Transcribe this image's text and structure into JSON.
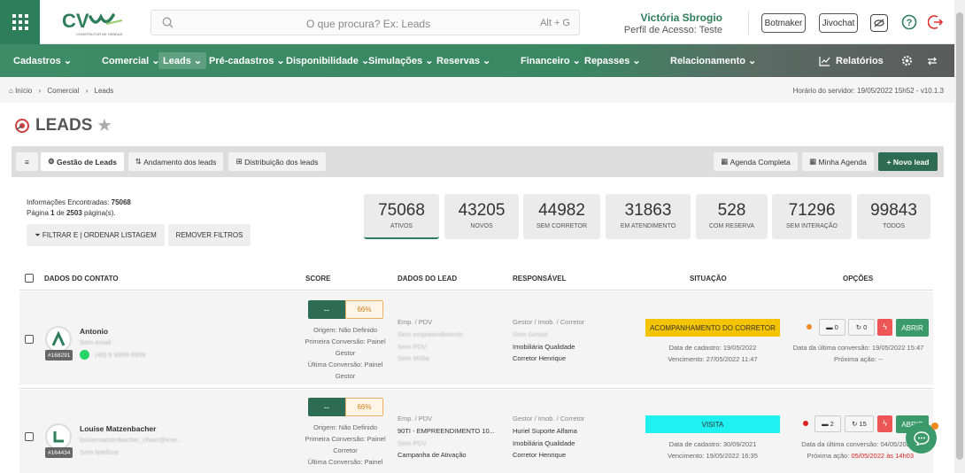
{
  "header": {
    "search_placeholder": "O que procura? Ex: Leads",
    "search_shortcut": "Alt + G",
    "user_name": "Victória Sbrogio",
    "user_profile": "Perfil de Acesso: Teste",
    "btn_botmaker": "Botmaker",
    "btn_jivochat": "Jivochat",
    "logo_sub": "CONSTRUTOR DE VENDAS"
  },
  "nav": {
    "items": [
      "Cadastros",
      "Comercial",
      "Leads",
      "Pré-cadastros",
      "Disponibilidade",
      "Simulações",
      "Reservas",
      "Financeiro",
      "Repasses",
      "Relacionamento",
      "Relatórios"
    ]
  },
  "breadcrumb": {
    "items": [
      "Início",
      "Comercial",
      "Leads"
    ],
    "server_time": "Horário do servidor: 19/05/2022 15h52 - v10.1.3"
  },
  "page": {
    "title": "LEADS"
  },
  "tabs": {
    "gestao": "Gestão de Leads",
    "andamento": "Andamento dos leads",
    "distribuicao": "Distribuição dos leads",
    "agenda_completa": "Agenda Completa",
    "minha_agenda": "Minha Agenda",
    "novo_lead": "Novo lead"
  },
  "info": {
    "found_label": "Informações Encontradas:",
    "found_value": "75068",
    "page_text_1": "Página",
    "page_num": "1",
    "page_text_2": "de",
    "page_total": "2503",
    "page_text_3": "página(s).",
    "filter_btn": "FILTRAR E | ORDENAR LISTAGEM",
    "remove_btn": "REMOVER FILTROS"
  },
  "stats": [
    {
      "value": "75068",
      "label": "ATIVOS"
    },
    {
      "value": "43205",
      "label": "NOVOS"
    },
    {
      "value": "44982",
      "label": "SEM CORRETOR"
    },
    {
      "value": "31863",
      "label": "EM ATENDIMENTO"
    },
    {
      "value": "528",
      "label": "COM RESERVA"
    },
    {
      "value": "71296",
      "label": "SEM INTERAÇÃO"
    },
    {
      "value": "99843",
      "label": "TODOS"
    }
  ],
  "table": {
    "headers": [
      "DADOS DO CONTATO",
      "SCORE",
      "DADOS DO LEAD",
      "RESPONSÁVEL",
      "SITUAÇÃO",
      "OPÇÕES"
    ],
    "rows": [
      {
        "name": "Antonio",
        "email": "Sem email",
        "phone": "(48) 9 9999-9999",
        "id": "#168291",
        "score_a": "--",
        "score_b": "66%",
        "origem": "Origem: Não Definido",
        "primeira": "Primeira Conversão: Painel Gestor",
        "ultima": "Última Conversão: Painel Gestor",
        "lead_label": "Emp. / PDV",
        "lead_1": "Sem empreendimento",
        "lead_2": "Sem PDV",
        "lead_3": "Sem Mídia",
        "resp_label": "Gestor / Imob. / Corretor",
        "resp_1": "Sem Gestor",
        "resp_2": "Imobiliária Qualidade",
        "resp_3": "Corretor Henrique",
        "situacao": "ACOMPANHAMENTO DO CORRETOR",
        "situacao_color": "#f5c400",
        "cadastro": "Data de cadastro: 19/05/2022",
        "vencimento": "Vencimento: 27/05/2022 11:47",
        "dot_color": "#f08a20",
        "msgs": "0",
        "refresh": "0",
        "ultima_conv": "Data da última conversão: 19/05/2022 15:47",
        "proxima_label": "Próxima ação:",
        "proxima_val": "--",
        "abrir": "ABRIR"
      },
      {
        "name": "Louise Matzenbacher",
        "email": "louisematzenbacher_chaer@exe...",
        "phone": "Sem telefone",
        "id": "#164434",
        "score_a": "--",
        "score_b": "66%",
        "origem": "Origem: Não Definido",
        "primeira": "Primeira Conversão: Painel Corretor",
        "ultima": "Última Conversão: Painel",
        "lead_label": "Emp. / PDV",
        "lead_1": "90TI - EMPREENDIMENTO 10...",
        "lead_2": "Sem PDV",
        "lead_3": "Campanha de Ativação",
        "resp_label": "Gestor / Imob. / Corretor",
        "resp_1": "Huriel Suporte Alfama",
        "resp_2": "Imobiliária Qualidade",
        "resp_3": "Corretor Henrique",
        "situacao": "VISITA",
        "situacao_color": "#1ff0f0",
        "cadastro": "Data de cadastro: 30/09/2021",
        "vencimento": "Vencimento: 19/05/2022 16:35",
        "dot_color": "#e02020",
        "msgs": "2",
        "refresh": "15",
        "ultima_conv": "Data da última conversão: 04/05/2022",
        "proxima_label": "Próxima ação:",
        "proxima_val": "05/05/2022 às 14h03",
        "abrir": "ABRIR"
      }
    ]
  }
}
